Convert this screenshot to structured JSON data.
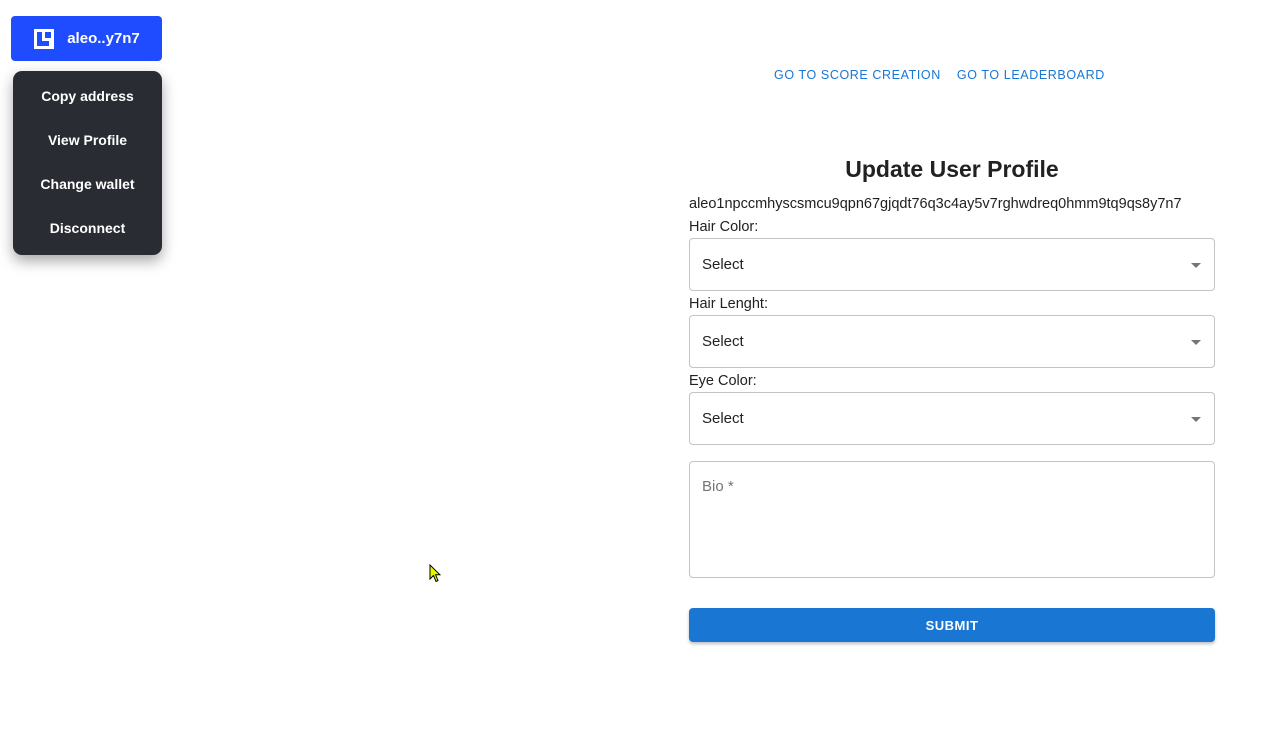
{
  "wallet": {
    "button_label": "aleo..y7n7",
    "logo_icon": "leo-wallet-logo-icon",
    "accent_color": "#1f4cff",
    "menu": [
      {
        "label": "Copy address"
      },
      {
        "label": "View Profile"
      },
      {
        "label": "Change wallet"
      },
      {
        "label": "Disconnect"
      }
    ]
  },
  "nav": {
    "score_creation": "GO TO SCORE CREATION",
    "leaderboard": "GO TO LEADERBOARD"
  },
  "form": {
    "title": "Update User Profile",
    "address": "aleo1npccmhyscsmcu9qpn67gjqdt76q3c4ay5v7rghwdreq0hmm9tq9qs8y7n7",
    "hair_color": {
      "label": "Hair Color:",
      "value": "Select"
    },
    "hair_length": {
      "label": "Hair Lenght:",
      "value": "Select"
    },
    "eye_color": {
      "label": "Eye Color:",
      "value": "Select"
    },
    "bio": {
      "placeholder": "Bio *"
    },
    "submit_label": "SUBMIT",
    "primary_color": "#1976d2"
  }
}
